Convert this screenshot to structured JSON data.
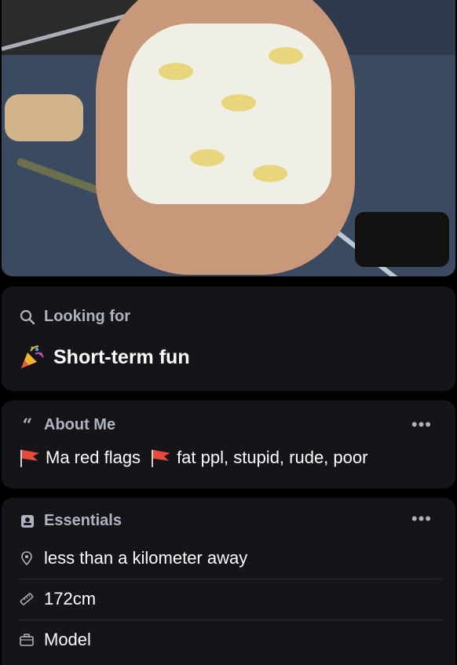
{
  "looking_for": {
    "title": "Looking for",
    "value": "Short-term fun",
    "value_icon": "party-popper-icon"
  },
  "about_me": {
    "title": "About Me",
    "text_part1": "Ma red flags",
    "text_part2": "fat ppl, stupid, rude, poor",
    "flag_icon": "red-flag-icon"
  },
  "essentials": {
    "title": "Essentials",
    "items": [
      {
        "icon": "location-pin-icon",
        "label": "less than a kilometer away"
      },
      {
        "icon": "ruler-icon",
        "label": "172cm"
      },
      {
        "icon": "briefcase-icon",
        "label": "Model"
      }
    ]
  },
  "colors": {
    "background": "#000000",
    "card": "#141419",
    "muted_text": "#aeb4bf",
    "text": "#ffffff",
    "flag": "#e84a3b"
  }
}
